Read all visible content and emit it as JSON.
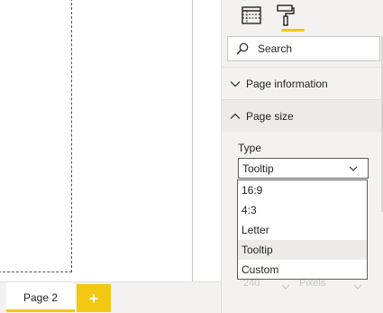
{
  "canvas": {},
  "tabs": {
    "pages": [
      {
        "label": "Page 2",
        "active": true
      }
    ],
    "add_page_label": "+"
  },
  "pane": {
    "views": [
      {
        "name": "fields-view",
        "icon": "table-icon"
      },
      {
        "name": "format-view",
        "icon": "paint-roller-icon",
        "active": true
      }
    ],
    "search": {
      "placeholder": "Search"
    },
    "sections": [
      {
        "label": "Page information",
        "expanded": false
      },
      {
        "label": "Page size",
        "expanded": true
      }
    ],
    "type_field": {
      "label": "Type",
      "value": "Tooltip",
      "options": [
        "16:9",
        "4:3",
        "Letter",
        "Tooltip",
        "Custom"
      ],
      "selected": "Tooltip"
    },
    "faded_text": {
      "value": "240",
      "unit": "Pixels"
    }
  },
  "colors": {
    "accent": "#f2c811",
    "pane_bg": "#f3f2f1",
    "border": "#605e5c",
    "selected_bg": "#edebe9"
  }
}
